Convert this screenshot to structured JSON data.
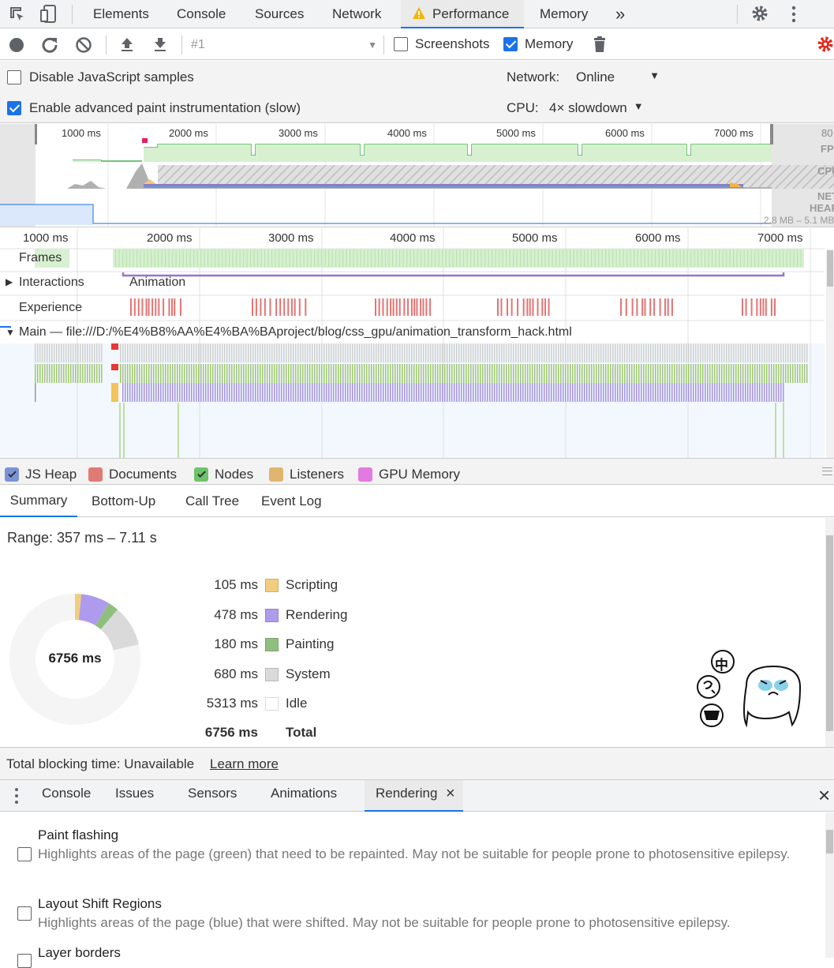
{
  "toolbar": {
    "tabs": [
      "Elements",
      "Console",
      "Sources",
      "Network",
      "Performance",
      "Memory"
    ],
    "more": "»"
  },
  "controls": {
    "profile_select": "#1",
    "screenshots_label": "Screenshots",
    "memory_label": "Memory"
  },
  "settings": {
    "disable_js_label": "Disable JavaScript samples",
    "advanced_paint_label": "Enable advanced paint instrumentation (slow)",
    "network_label": "Network:",
    "network_value": "Online",
    "cpu_label": "CPU:",
    "cpu_value": "4× slowdown"
  },
  "overview": {
    "ticks": [
      "1000 ms",
      "2000 ms",
      "3000 ms",
      "4000 ms",
      "5000 ms",
      "6000 ms",
      "7000 ms"
    ],
    "fps_label": "FPS",
    "fps_value": "80",
    "cpu_label": "CPU",
    "net_label": "NET",
    "heap_label": "HEAP",
    "heap_range": "2.8 MB – 5.1 MB"
  },
  "timeline": {
    "ticks": [
      "1000 ms",
      "2000 ms",
      "3000 ms",
      "4000 ms",
      "5000 ms",
      "6000 ms",
      "7000 ms"
    ],
    "frames_label": "Frames",
    "interactions_label": "Interactions",
    "animation_label": "Animation",
    "experience_label": "Experience",
    "main_label": "Main — file:///D:/%E4%B8%AA%E4%BA%BAproject/blog/css_gpu/animation_transform_hack.html"
  },
  "legend": {
    "js_heap": "JS Heap",
    "documents": "Documents",
    "nodes": "Nodes",
    "listeners": "Listeners",
    "gpu_memory": "GPU Memory"
  },
  "detail_tabs": [
    "Summary",
    "Bottom-Up",
    "Call Tree",
    "Event Log"
  ],
  "summary": {
    "range": "Range: 357 ms – 7.11 s",
    "total_center": "6756 ms",
    "rows": [
      {
        "value": "105 ms",
        "label": "Scripting",
        "color": "#f2cd7d"
      },
      {
        "value": "478 ms",
        "label": "Rendering",
        "color": "#af9bed"
      },
      {
        "value": "180 ms",
        "label": "Painting",
        "color": "#8fbf7e"
      },
      {
        "value": "680 ms",
        "label": "System",
        "color": "#dadada"
      },
      {
        "value": "5313 ms",
        "label": "Idle",
        "color": "#ffffff"
      }
    ],
    "total_value": "6756 ms",
    "total_label": "Total",
    "sticker_text": "中"
  },
  "blocking": {
    "text": "Total blocking time: Unavailable",
    "link": "Learn more"
  },
  "drawer": {
    "tabs": [
      "Console",
      "Issues",
      "Sensors",
      "Animations",
      "Rendering"
    ],
    "active_close": "×",
    "close": "×"
  },
  "rendering": {
    "options": [
      {
        "title": "Paint flashing",
        "desc": "Highlights areas of the page (green) that need to be repainted. May not be suitable for people prone to photosensitive epilepsy."
      },
      {
        "title": "Layout Shift Regions",
        "desc": "Highlights areas of the page (blue) that were shifted. May not be suitable for people prone to photosensitive epilepsy."
      },
      {
        "title": "Layer borders",
        "desc": ""
      }
    ]
  }
}
